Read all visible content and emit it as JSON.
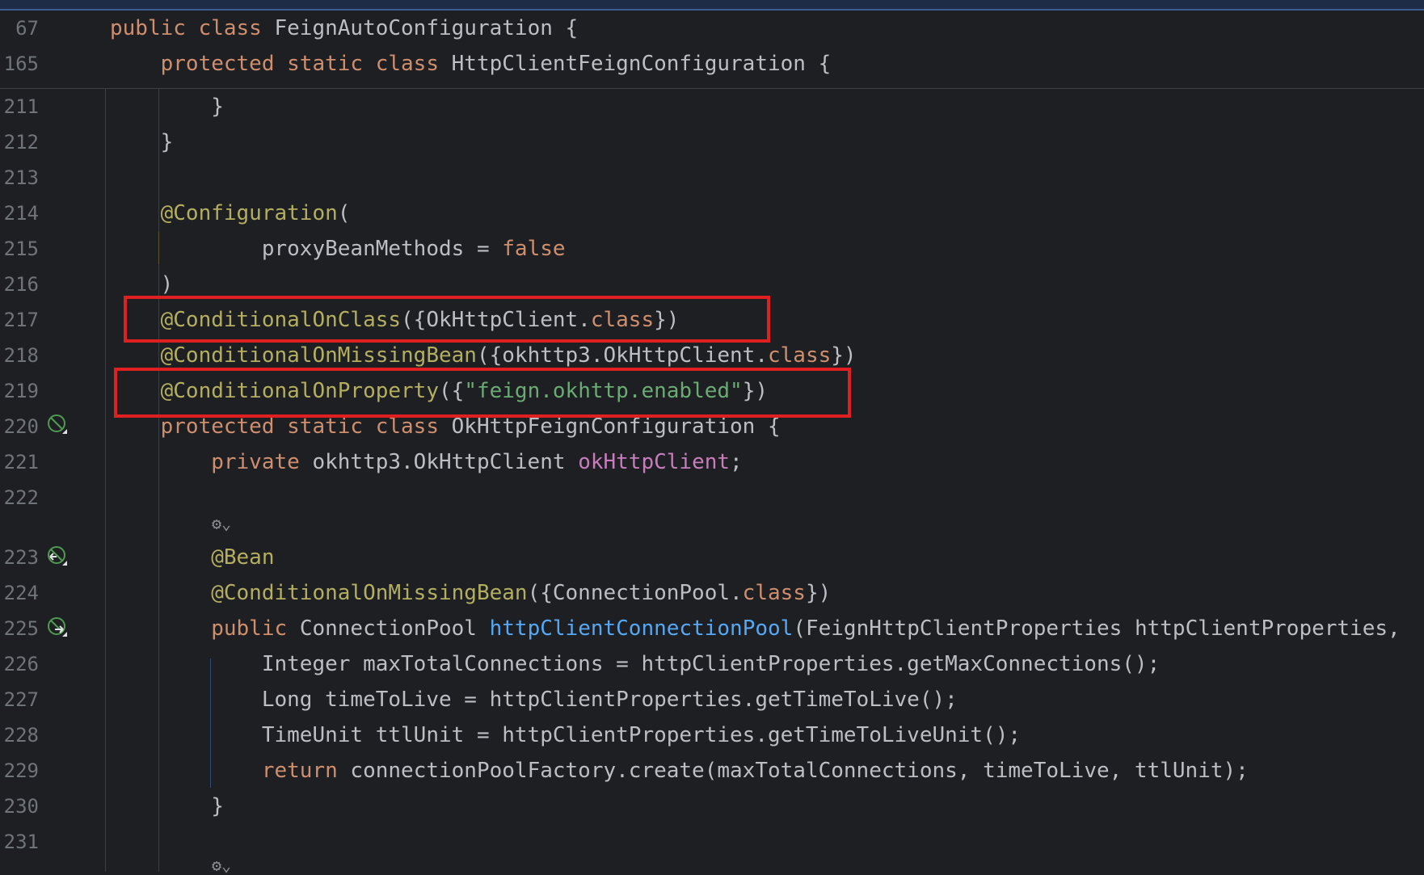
{
  "lines": [
    {
      "num": "67",
      "tokens": [
        {
          "t": "public class ",
          "c": "kw"
        },
        {
          "t": "FeignAutoConfiguration {",
          "c": ""
        }
      ]
    },
    {
      "num": "165",
      "tokens": [
        {
          "t": "    protected static class ",
          "c": "kw"
        },
        {
          "t": "HttpClientFeignConfiguration {",
          "c": ""
        }
      ]
    },
    {
      "num": "211",
      "tokens": [
        {
          "t": "        }",
          "c": ""
        }
      ]
    },
    {
      "num": "212",
      "tokens": [
        {
          "t": "    }",
          "c": ""
        }
      ]
    },
    {
      "num": "213",
      "tokens": []
    },
    {
      "num": "214",
      "tokens": [
        {
          "t": "    @Configuration",
          "c": "ann"
        },
        {
          "t": "(",
          "c": ""
        }
      ]
    },
    {
      "num": "215",
      "tokens": [
        {
          "t": "            proxyBeanMethods = ",
          "c": ""
        },
        {
          "t": "false",
          "c": "kw"
        }
      ]
    },
    {
      "num": "216",
      "tokens": [
        {
          "t": "    )",
          "c": ""
        }
      ]
    },
    {
      "num": "217",
      "tokens": [
        {
          "t": "    @ConditionalOnClass",
          "c": "ann"
        },
        {
          "t": "({OkHttpClient.",
          "c": ""
        },
        {
          "t": "class",
          "c": "kw"
        },
        {
          "t": "})",
          "c": ""
        }
      ]
    },
    {
      "num": "218",
      "tokens": [
        {
          "t": "    @ConditionalOnMissingBean",
          "c": "ann"
        },
        {
          "t": "({okhttp3.OkHttpClient.",
          "c": ""
        },
        {
          "t": "class",
          "c": "kw"
        },
        {
          "t": "})",
          "c": ""
        }
      ]
    },
    {
      "num": "219",
      "tokens": [
        {
          "t": "    @ConditionalOnProperty",
          "c": "ann"
        },
        {
          "t": "({",
          "c": ""
        },
        {
          "t": "\"feign.okhttp.enabled\"",
          "c": "str"
        },
        {
          "t": "})",
          "c": ""
        }
      ]
    },
    {
      "num": "220",
      "tokens": [
        {
          "t": "    protected static class ",
          "c": "kw"
        },
        {
          "t": "OkHttpFeignConfiguration {",
          "c": ""
        }
      ]
    },
    {
      "num": "221",
      "tokens": [
        {
          "t": "        private ",
          "c": "kw"
        },
        {
          "t": "okhttp3.OkHttpClient ",
          "c": ""
        },
        {
          "t": "okHttpClient",
          "c": "fld"
        },
        {
          "t": ";",
          "c": ""
        }
      ]
    },
    {
      "num": "222",
      "tokens": []
    },
    {
      "num": "223",
      "tokens": [
        {
          "t": "        @Bean",
          "c": "ann"
        }
      ]
    },
    {
      "num": "224",
      "tokens": [
        {
          "t": "        @ConditionalOnMissingBean",
          "c": "ann"
        },
        {
          "t": "({ConnectionPool.",
          "c": ""
        },
        {
          "t": "class",
          "c": "kw"
        },
        {
          "t": "})",
          "c": ""
        }
      ]
    },
    {
      "num": "225",
      "tokens": [
        {
          "t": "        public ",
          "c": "kw"
        },
        {
          "t": "ConnectionPool ",
          "c": ""
        },
        {
          "t": "httpClientConnectionPool",
          "c": "mth"
        },
        {
          "t": "(FeignHttpClientProperties httpClientProperties,",
          "c": ""
        }
      ]
    },
    {
      "num": "226",
      "tokens": [
        {
          "t": "            Integer maxTotalConnections = httpClientProperties.getMaxConnections();",
          "c": ""
        }
      ]
    },
    {
      "num": "227",
      "tokens": [
        {
          "t": "            Long timeToLive = httpClientProperties.getTimeToLive();",
          "c": ""
        }
      ]
    },
    {
      "num": "228",
      "tokens": [
        {
          "t": "            TimeUnit ttlUnit = httpClientProperties.getTimeToLiveUnit();",
          "c": ""
        }
      ]
    },
    {
      "num": "229",
      "tokens": [
        {
          "t": "            return ",
          "c": "kw"
        },
        {
          "t": "connectionPoolFactory.create(maxTotalConnections, timeToLive, ttlUnit);",
          "c": ""
        }
      ]
    },
    {
      "num": "230",
      "tokens": [
        {
          "t": "        }",
          "c": ""
        }
      ]
    },
    {
      "num": "231",
      "tokens": []
    }
  ],
  "gutter_icons": [
    {
      "line": "220",
      "icon": "bean-class-icon"
    },
    {
      "line": "223",
      "icon": "bean-navigate-icon"
    },
    {
      "line": "225",
      "icon": "bean-method-icon"
    }
  ],
  "inlay_hints": [
    "⚙⌄",
    "⚙⌄"
  ],
  "highlights": [
    "line-217",
    "line-219"
  ]
}
